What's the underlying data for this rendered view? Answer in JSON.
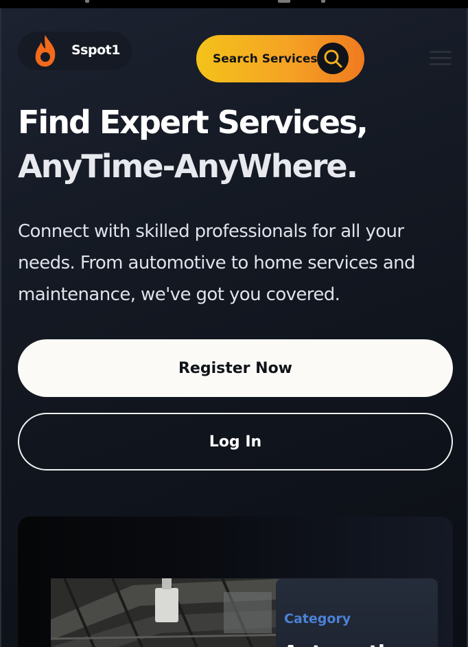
{
  "header": {
    "brand_name": "Sspot1",
    "brand_icon": "flame-icon",
    "accent_color": "#f5a324",
    "search_label": "Search Services",
    "search_icon": "search-icon",
    "menu_icon": "hamburger-menu-icon"
  },
  "hero": {
    "title_line1": "Find Expert Services,",
    "title_line2": "AnyTime-AnyWhere.",
    "description": "Connect with skilled professionals for all your needs. From automotive to home services and maintenance, we've got you covered."
  },
  "actions": {
    "register_label": "Register Now",
    "login_label": "Log In"
  },
  "card": {
    "category_label": "Category",
    "title": "Automotive"
  }
}
